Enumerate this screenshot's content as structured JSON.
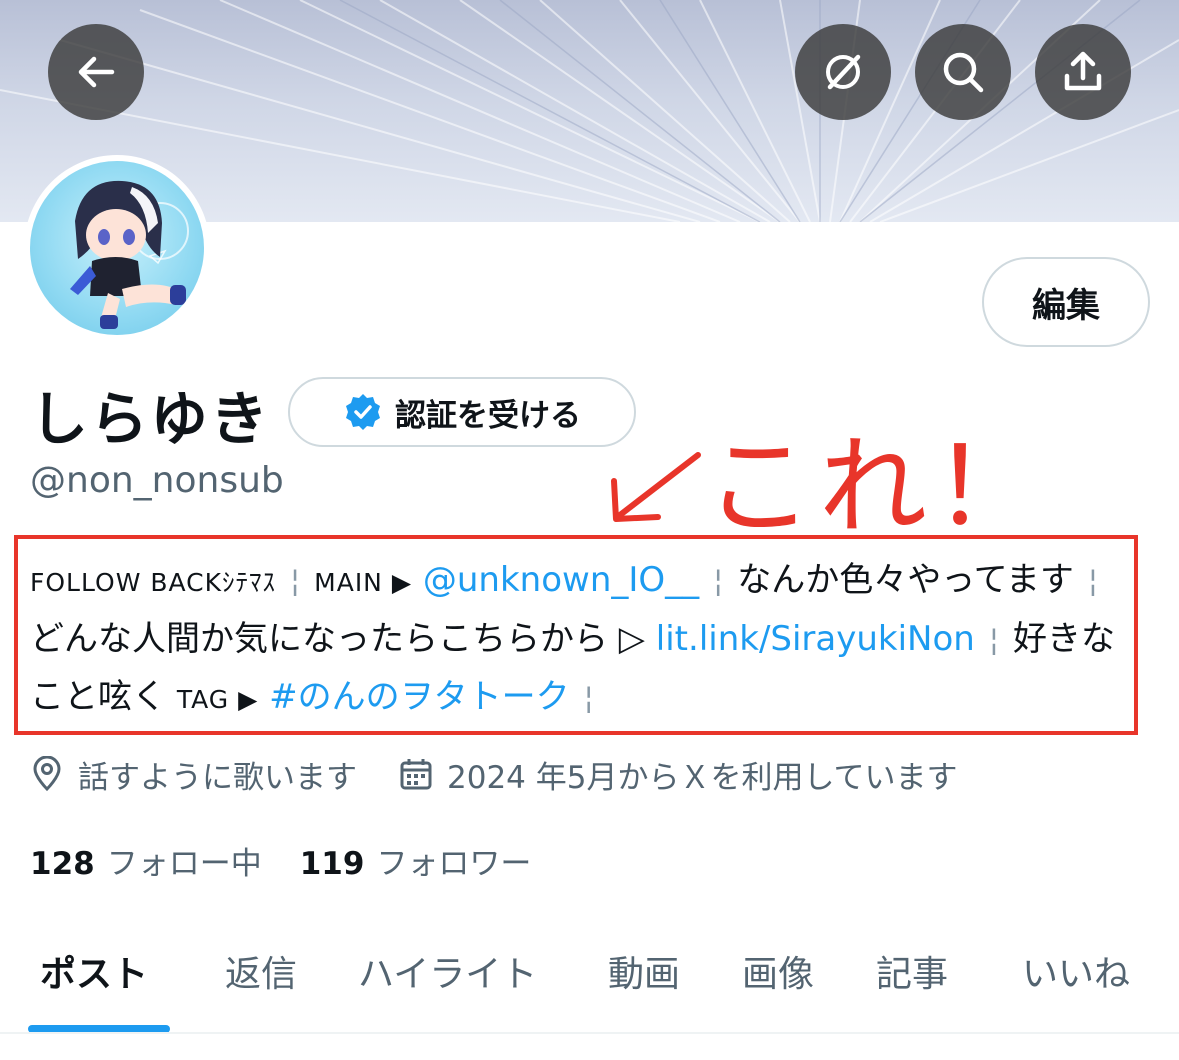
{
  "header": {
    "back_icon": "arrow-left-icon",
    "action_icons": [
      "grok-icon",
      "search-icon",
      "share-icon"
    ]
  },
  "profile": {
    "edit_label": "編集",
    "display_name": "しらゆき",
    "verify_label": "認証を受ける",
    "handle": "@non_nonsub",
    "bio": {
      "part1": "FOLLOW BACKｼﾃﾏｽ",
      "sep": "¦",
      "main_label": "MAIN ▶︎",
      "main_link": "@unknown_IO__",
      "text1": "なんか色々やってます",
      "text2": "どんな人間か気になったらこちらから ▷",
      "url_link": "lit.link/SirayukiNon",
      "text3": "好きなこと呟く",
      "tag_label": "TAG ▶︎",
      "hashtag": "#のんのヲタトーク"
    },
    "location": "話すように歌います",
    "joined": "2024 年5月からＸを利用しています",
    "following_count": "128",
    "following_label": "フォロー中",
    "followers_count": "119",
    "followers_label": "フォロワー"
  },
  "annotation": {
    "text": "これ！",
    "color": "#e8352a"
  },
  "tabs": [
    "ポスト",
    "返信",
    "ハイライト",
    "動画",
    "画像",
    "記事",
    "いいね"
  ],
  "colors": {
    "accent": "#1d9bf0",
    "verified": "#1d9bf0",
    "annotation": "#e8352a"
  }
}
